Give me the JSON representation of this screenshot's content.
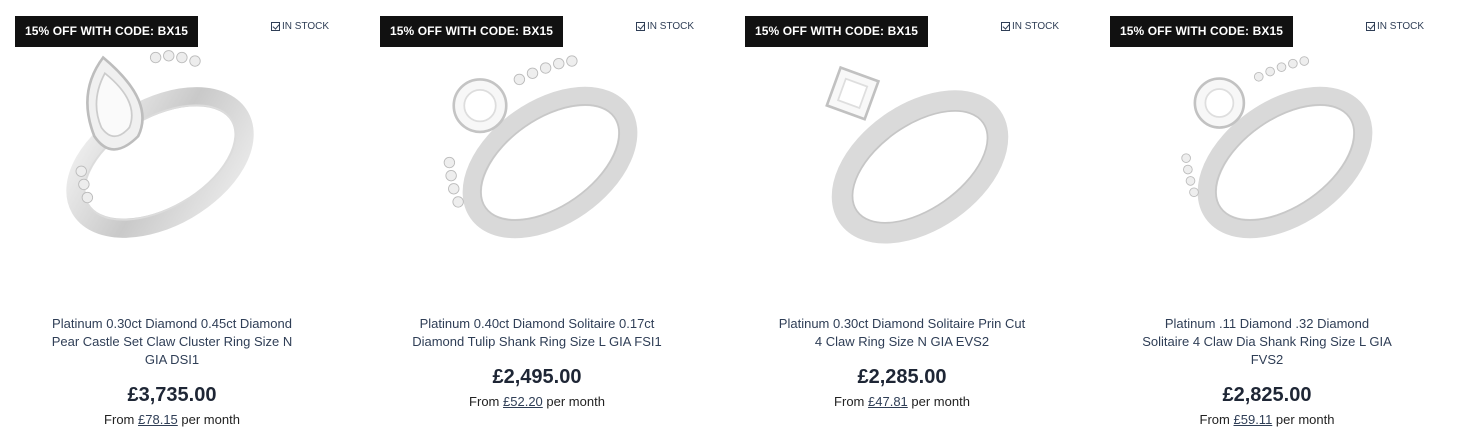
{
  "products": [
    {
      "promo": "15% OFF WITH CODE: BX15",
      "stock": "IN STOCK",
      "title": "Platinum 0.30ct Diamond 0.45ct Diamond Pear Castle Set Claw Cluster Ring Size N GIA DSI1",
      "price": "£3,735.00",
      "finance_prefix": "From",
      "finance_amount": "£78.15",
      "finance_suffix": "per month",
      "image_icon": "pear-halo-ring"
    },
    {
      "promo": "15% OFF WITH CODE: BX15",
      "stock": "IN STOCK",
      "title": "Platinum 0.40ct Diamond Solitaire 0.17ct Diamond Tulip Shank Ring Size L GIA FSI1",
      "price": "£2,495.00",
      "finance_prefix": "From",
      "finance_amount": "£52.20",
      "finance_suffix": "per month",
      "image_icon": "round-solitaire-pave-ring"
    },
    {
      "promo": "15% OFF WITH CODE: BX15",
      "stock": "IN STOCK",
      "title": "Platinum 0.30ct Diamond Solitaire Prin Cut 4 Claw Ring Size N GIA EVS2",
      "price": "£2,285.00",
      "finance_prefix": "From",
      "finance_amount": "£47.81",
      "finance_suffix": "per month",
      "image_icon": "princess-solitaire-ring"
    },
    {
      "promo": "15% OFF WITH CODE: BX15",
      "stock": "IN STOCK",
      "title": "Platinum .11 Diamond .32 Diamond Solitaire 4 Claw Dia Shank Ring Size L GIA FVS2",
      "price": "£2,825.00",
      "finance_prefix": "From",
      "finance_amount": "£59.11",
      "finance_suffix": "per month",
      "image_icon": "round-solitaire-channel-ring"
    }
  ]
}
